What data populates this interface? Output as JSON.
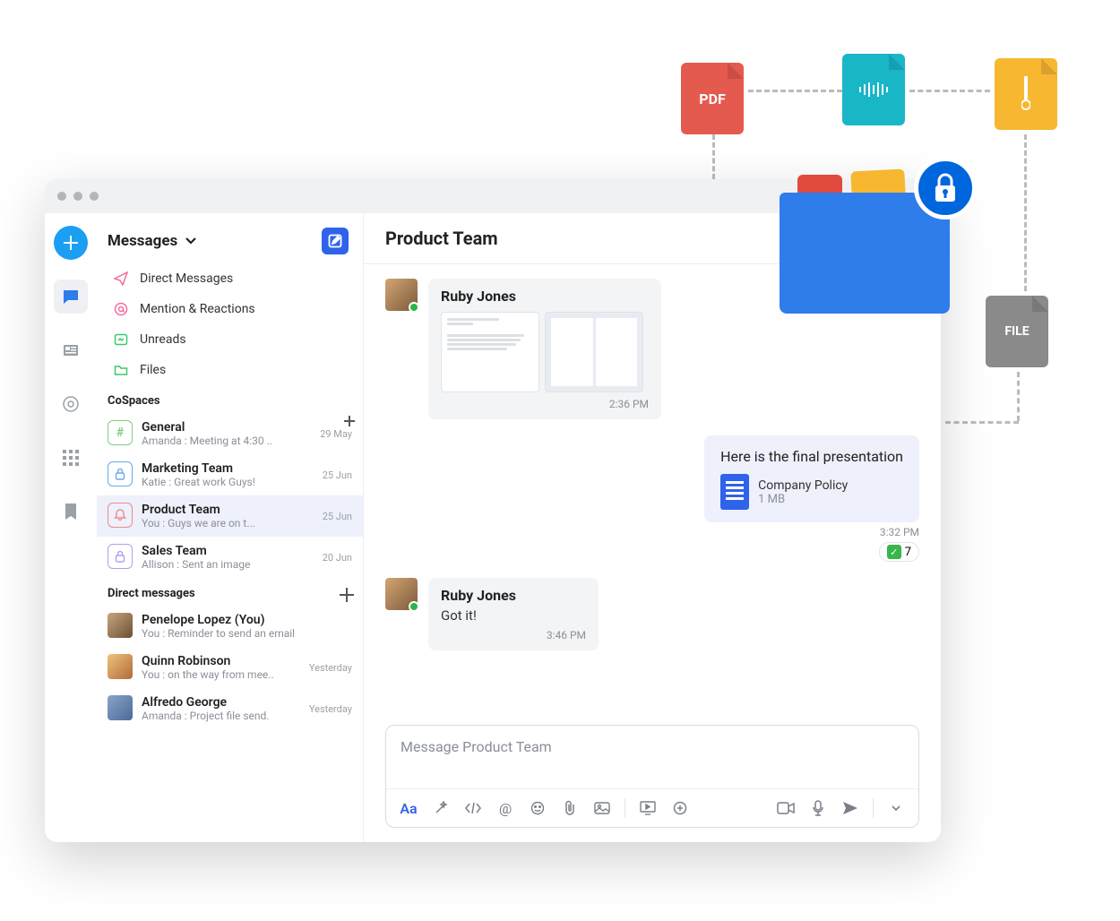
{
  "floating": {
    "pdf_label": "PDF",
    "file_label": "FILE"
  },
  "sidebar": {
    "title": "Messages",
    "filters": {
      "direct_messages": "Direct Messages",
      "mentions": "Mention & Reactions",
      "unreads": "Unreads",
      "files": "Files"
    },
    "cospaces_label": "CoSpaces",
    "spaces": [
      {
        "name": "General",
        "preview": "Amanda : Meeting at 4:30 ..",
        "date": "29 May",
        "color": "#7bd17b",
        "icon": "#"
      },
      {
        "name": "Marketing Team",
        "preview": "Katie : Great work Guys!",
        "date": "25 Jun",
        "color": "#6aa7f0",
        "icon": "lock"
      },
      {
        "name": "Product Team",
        "preview": "You : Guys we are on t...",
        "date": "25 Jun",
        "color": "#f08a8a",
        "icon": "bell",
        "active": true
      },
      {
        "name": "Sales Team",
        "preview": "Allison : Sent an image",
        "date": "20 Jun",
        "color": "#b49df0",
        "icon": "lock"
      }
    ],
    "directs_label": "Direct messages",
    "directs": [
      {
        "name": "Penelope Lopez (You)",
        "preview": "You : Reminder to send an email",
        "date": ""
      },
      {
        "name": "Quinn Robinson",
        "preview": "You : on the way from mee..",
        "date": "Yesterday"
      },
      {
        "name": "Alfredo George",
        "preview": "Amanda : Project file send.",
        "date": "Yesterday"
      }
    ]
  },
  "chat": {
    "title": "Product Team",
    "messages": {
      "ruby1_sender": "Ruby Jones",
      "ruby1_time": "2:36 PM",
      "out_text": "Here is the final presentation",
      "out_file_name": "Company Policy",
      "out_file_size": "1 MB",
      "out_time": "3:32 PM",
      "out_reaction_count": "7",
      "ruby2_sender": "Ruby Jones",
      "ruby2_text": "Got it!",
      "ruby2_time": "3:46 PM"
    },
    "composer_placeholder": "Message Product Team"
  }
}
